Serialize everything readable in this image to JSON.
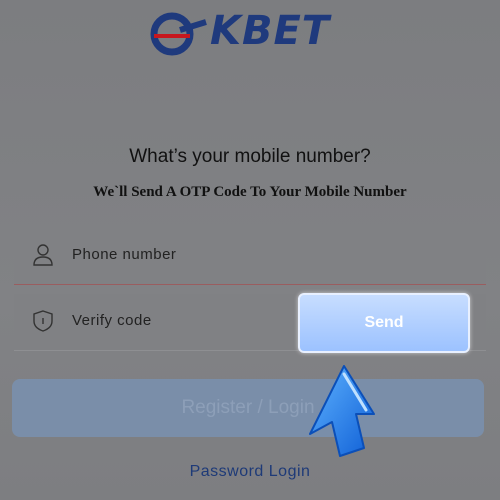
{
  "brand": {
    "name": "OKBET",
    "logo_text": "KBET"
  },
  "form": {
    "title": "What’s your mobile number?",
    "subtitle": "We`ll Send A OTP Code To Your Mobile Number",
    "phone": {
      "placeholder": "Phone number",
      "icon": "user-icon"
    },
    "code": {
      "placeholder": "Verify code",
      "icon": "shield-icon"
    },
    "send_label": "Send",
    "register_label": "Register / Login",
    "password_login_label": "Password Login"
  },
  "colors": {
    "overlay": "#808184",
    "send_button": "#a8c9ff",
    "register_button": "#7a8ea9",
    "link": "#1e3a78",
    "pointer": "#1f7df0"
  },
  "annotation": {
    "pointer": "hand-pointer-icon"
  }
}
